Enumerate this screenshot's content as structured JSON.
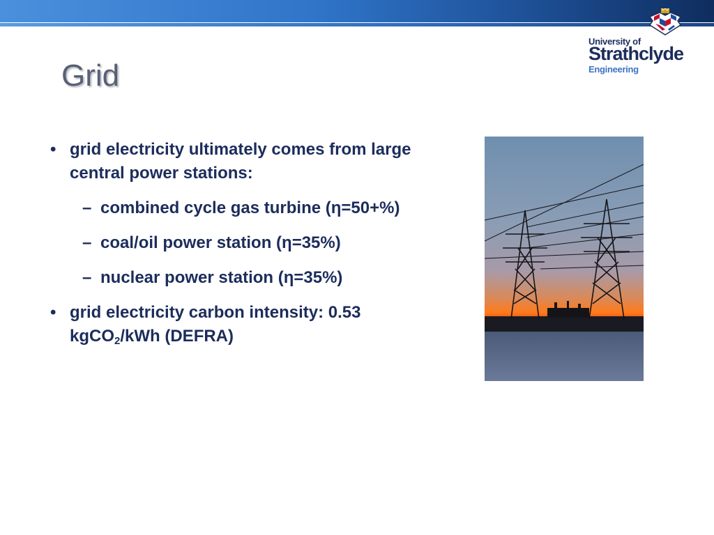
{
  "slide": {
    "title": "Grid",
    "bullets": [
      {
        "marker": "•",
        "text": "grid electricity ultimately comes from large central power stations:"
      },
      {
        "marker": "–",
        "text": "combined cycle gas turbine (η=50+%)"
      },
      {
        "marker": "–",
        "text": "coal/oil power station (η=35%)"
      },
      {
        "marker": "–",
        "text": "nuclear power station (η=35%)"
      },
      {
        "marker": "•",
        "text_before": "grid electricity carbon intensity: 0.53 kgCO",
        "subscript": "2",
        "text_after": "/kWh (DEFRA)"
      }
    ]
  },
  "logo": {
    "line1": "University of",
    "line2": "Strathclyde",
    "line3": "Engineering"
  },
  "colors": {
    "title": "#586078",
    "body_text": "#1c2d5c",
    "accent_blue": "#2f74c8",
    "logo_navy": "#1c2d5c",
    "logo_light_blue": "#3d74c4"
  }
}
